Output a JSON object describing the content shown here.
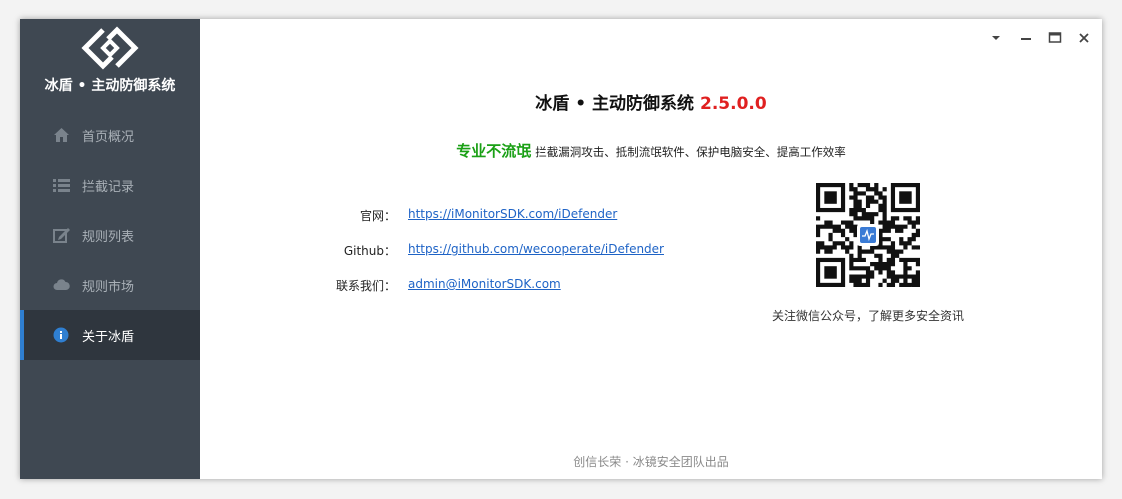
{
  "app": {
    "name": "冰盾 • 主动防御系统",
    "logo": "diamond-link-logo"
  },
  "sidebar": {
    "items": [
      {
        "label": "首页概况",
        "icon": "home-icon"
      },
      {
        "label": "拦截记录",
        "icon": "list-icon"
      },
      {
        "label": "规则列表",
        "icon": "edit-icon"
      },
      {
        "label": "规则市场",
        "icon": "cloud-icon"
      },
      {
        "label": "关于冰盾",
        "icon": "info-icon",
        "active": true
      }
    ]
  },
  "window_controls": [
    "dropdown-icon",
    "minimize-icon",
    "maximize-icon",
    "close-icon"
  ],
  "about": {
    "title": "冰盾 • 主动防御系统",
    "version": "2.5.0.0",
    "slogan_bold": "专业不流氓",
    "slogan": "拦截漏洞攻击、抵制流氓软件、保护电脑安全、提高工作效率",
    "info": [
      {
        "label": "官网：",
        "value": "https://iMonitorSDK.com/iDefender"
      },
      {
        "label": "Github：",
        "value": "https://github.com/wecooperate/iDefender"
      },
      {
        "label": "联系我们：",
        "value": "admin@iMonitorSDK.com"
      }
    ],
    "qr_caption": "关注微信公众号，了解更多安全资讯"
  },
  "footer": "创信长荣 · 冰镜安全团队出品",
  "colors": {
    "sidebar_bg": "#3f4852",
    "sidebar_active_bg": "#2f363e",
    "accent": "#2f7fd1",
    "version": "#e02020",
    "slogan": "#1aa015",
    "link": "#1e63c6"
  }
}
